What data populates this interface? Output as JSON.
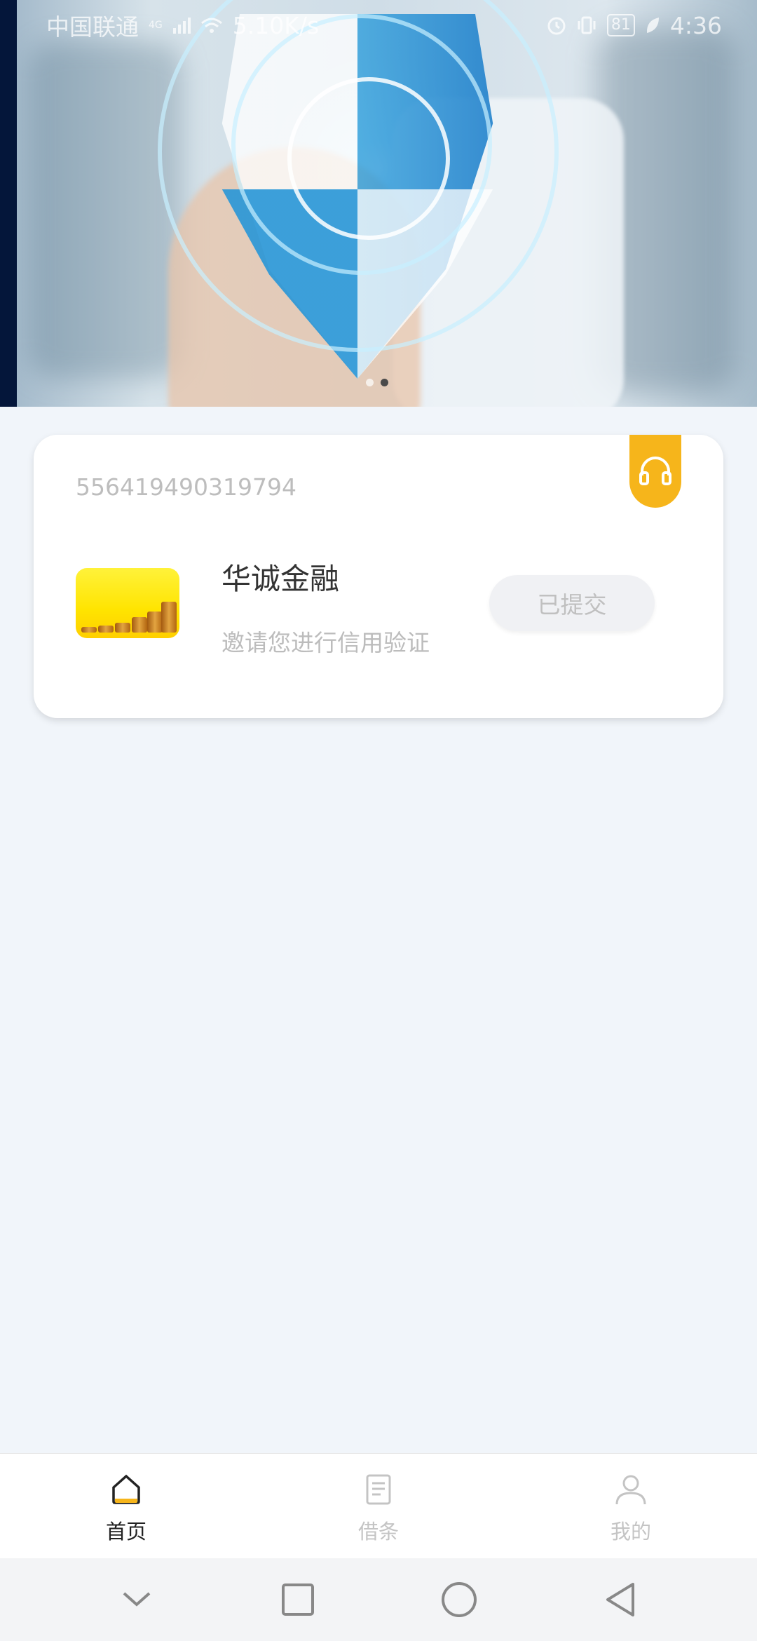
{
  "status_bar": {
    "carrier": "中国联通",
    "network": "4G",
    "speed": "5.10K/s",
    "battery": "81",
    "time": "4:36"
  },
  "banner": {
    "slide_count": 2,
    "active_slide": 2
  },
  "card": {
    "account_number": "556419490319794",
    "company_name": "华诚金融",
    "invite_text": "邀请您进行信用验证",
    "status_button": "已提交",
    "support_icon": "headset-icon"
  },
  "tabbar": {
    "items": [
      {
        "label": "首页",
        "icon": "home-icon",
        "active": true
      },
      {
        "label": "借条",
        "icon": "document-icon",
        "active": false
      },
      {
        "label": "我的",
        "icon": "person-icon",
        "active": false
      }
    ]
  },
  "navbar": {
    "buttons": [
      "chevron-down-icon",
      "recents-icon",
      "home-circle-icon",
      "back-icon"
    ]
  },
  "colors": {
    "accent": "#f6b51b",
    "background": "#f1f5fa"
  }
}
